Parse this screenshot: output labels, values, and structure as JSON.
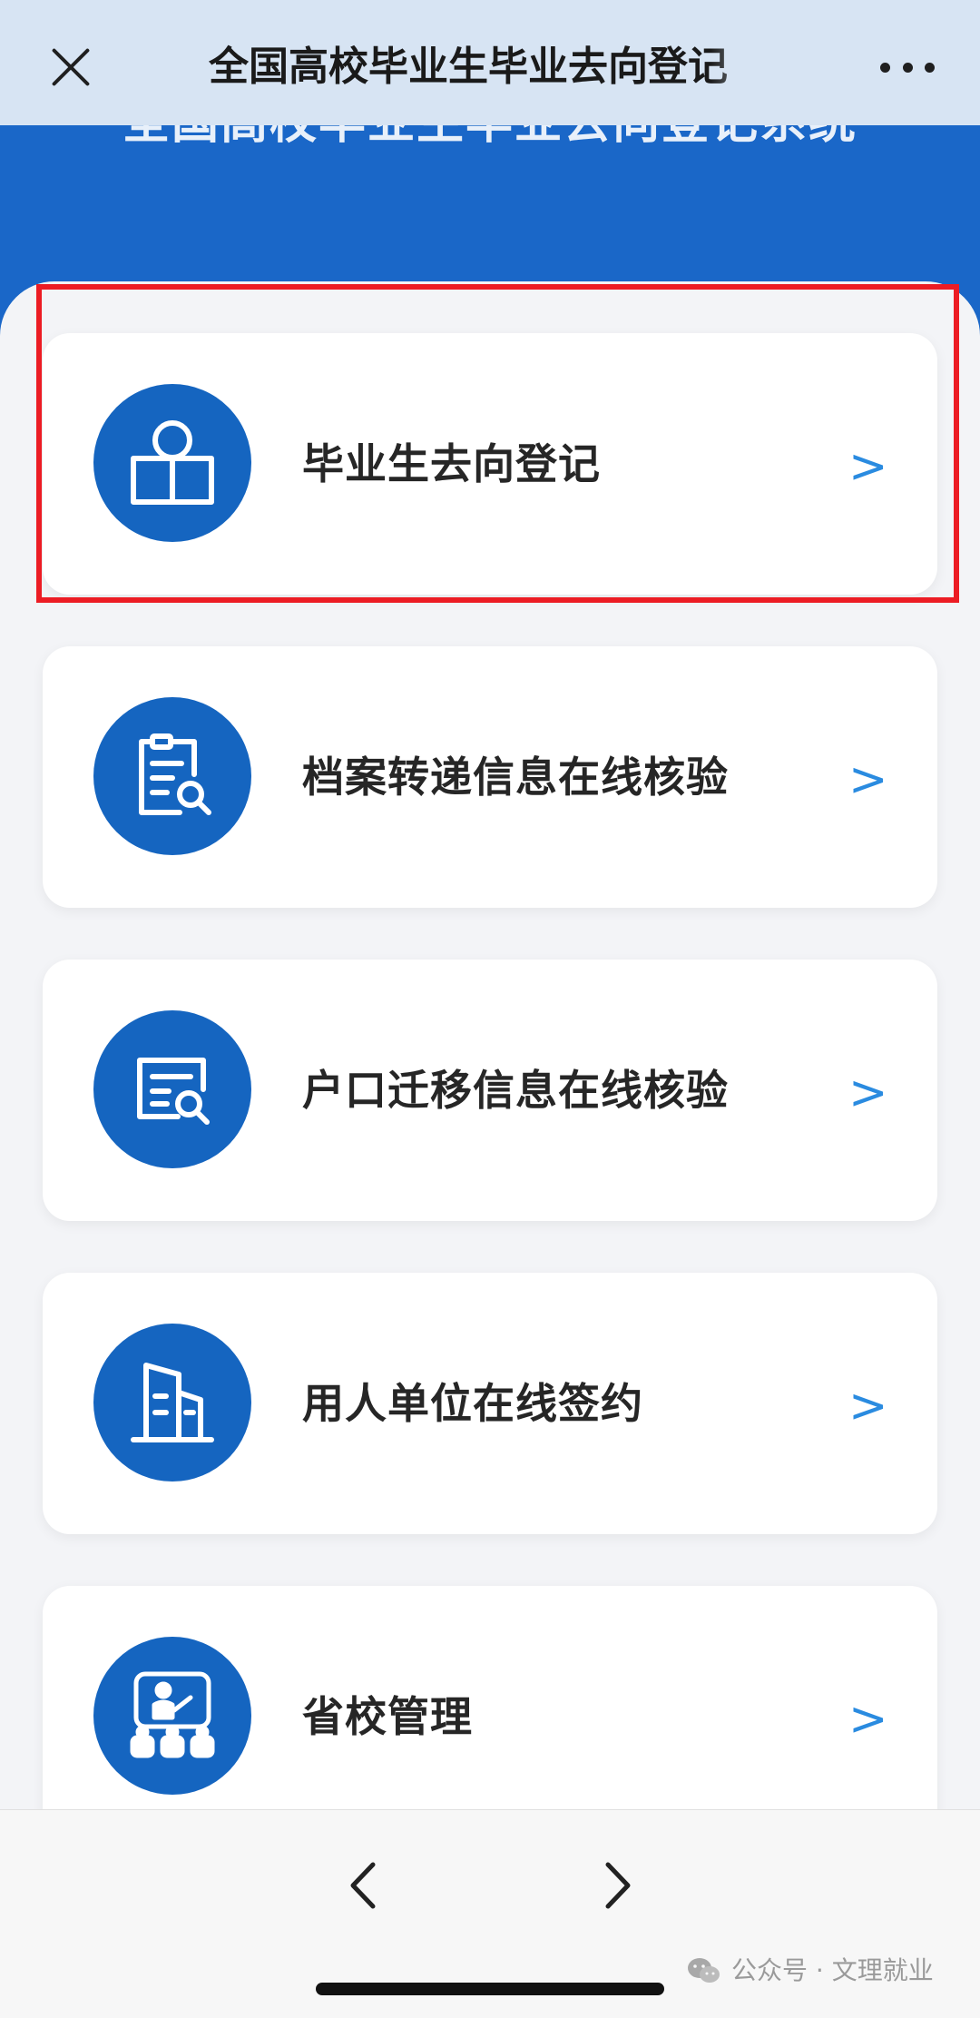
{
  "topbar": {
    "title": "全国高校毕业生毕业去向登记",
    "close_icon": "close-icon",
    "more_icon": "more-icon"
  },
  "hero": {
    "title": "全国高校毕业生毕业去向登记系统"
  },
  "menu": {
    "items": [
      {
        "label": "毕业生去向登记",
        "arrow": ">",
        "icon": "reader-book-icon",
        "highlighted": true
      },
      {
        "label": "档案转递信息在线核验",
        "arrow": ">",
        "icon": "document-search-icon"
      },
      {
        "label": "户口迁移信息在线核验",
        "arrow": ">",
        "icon": "card-search-icon"
      },
      {
        "label": "用人单位在线签约",
        "arrow": ">",
        "icon": "building-icon"
      },
      {
        "label": "省校管理",
        "arrow": ">",
        "icon": "classroom-icon"
      }
    ]
  },
  "bottombar": {
    "back_icon": "chevron-left-icon",
    "forward_icon": "chevron-right-icon"
  },
  "watermark": {
    "text": "公众号 · 文理就业",
    "icon": "wechat-icon"
  },
  "colors": {
    "primary": "#1565c0",
    "hero": "#1a67c8",
    "arrow": "#2a8be0",
    "highlight": "#ec1c24",
    "topbar": "#d7e4f3"
  }
}
